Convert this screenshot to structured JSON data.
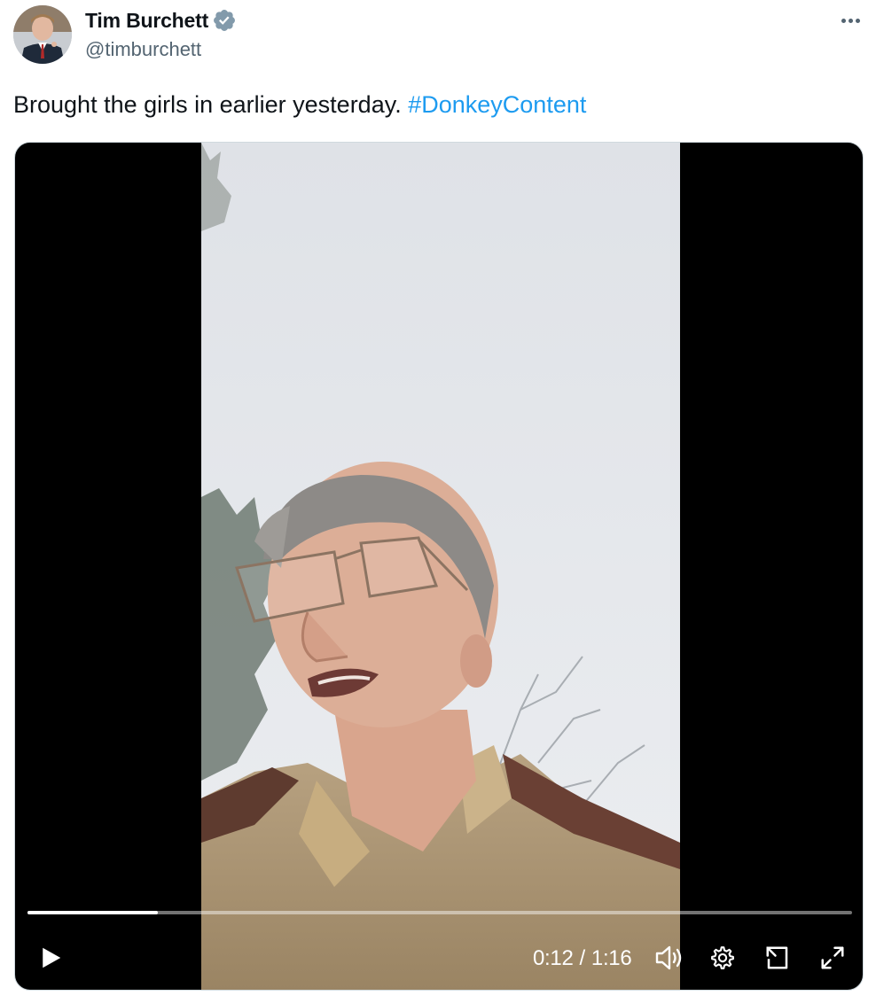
{
  "author": {
    "display_name": "Tim Burchett",
    "handle": "@timburchett",
    "verified": true,
    "avatar_icon": "profile-photo",
    "verified_icon": "verified-badge-icon",
    "verified_color": "#829aab"
  },
  "header": {
    "more_icon": "more-options-icon"
  },
  "tweet": {
    "text": "Brought the girls in earlier yesterday.",
    "hashtag": "#DonkeyContent",
    "hashtag_color": "#1d9bf0"
  },
  "video": {
    "current_time": "0:12",
    "separator": "/",
    "duration": "1:16",
    "progress_fraction": 0.158,
    "state": "paused",
    "icons": {
      "play": "play-icon",
      "volume": "volume-icon",
      "settings": "settings-gear-icon",
      "pip": "picture-in-picture-icon",
      "fullscreen": "fullscreen-icon"
    }
  }
}
